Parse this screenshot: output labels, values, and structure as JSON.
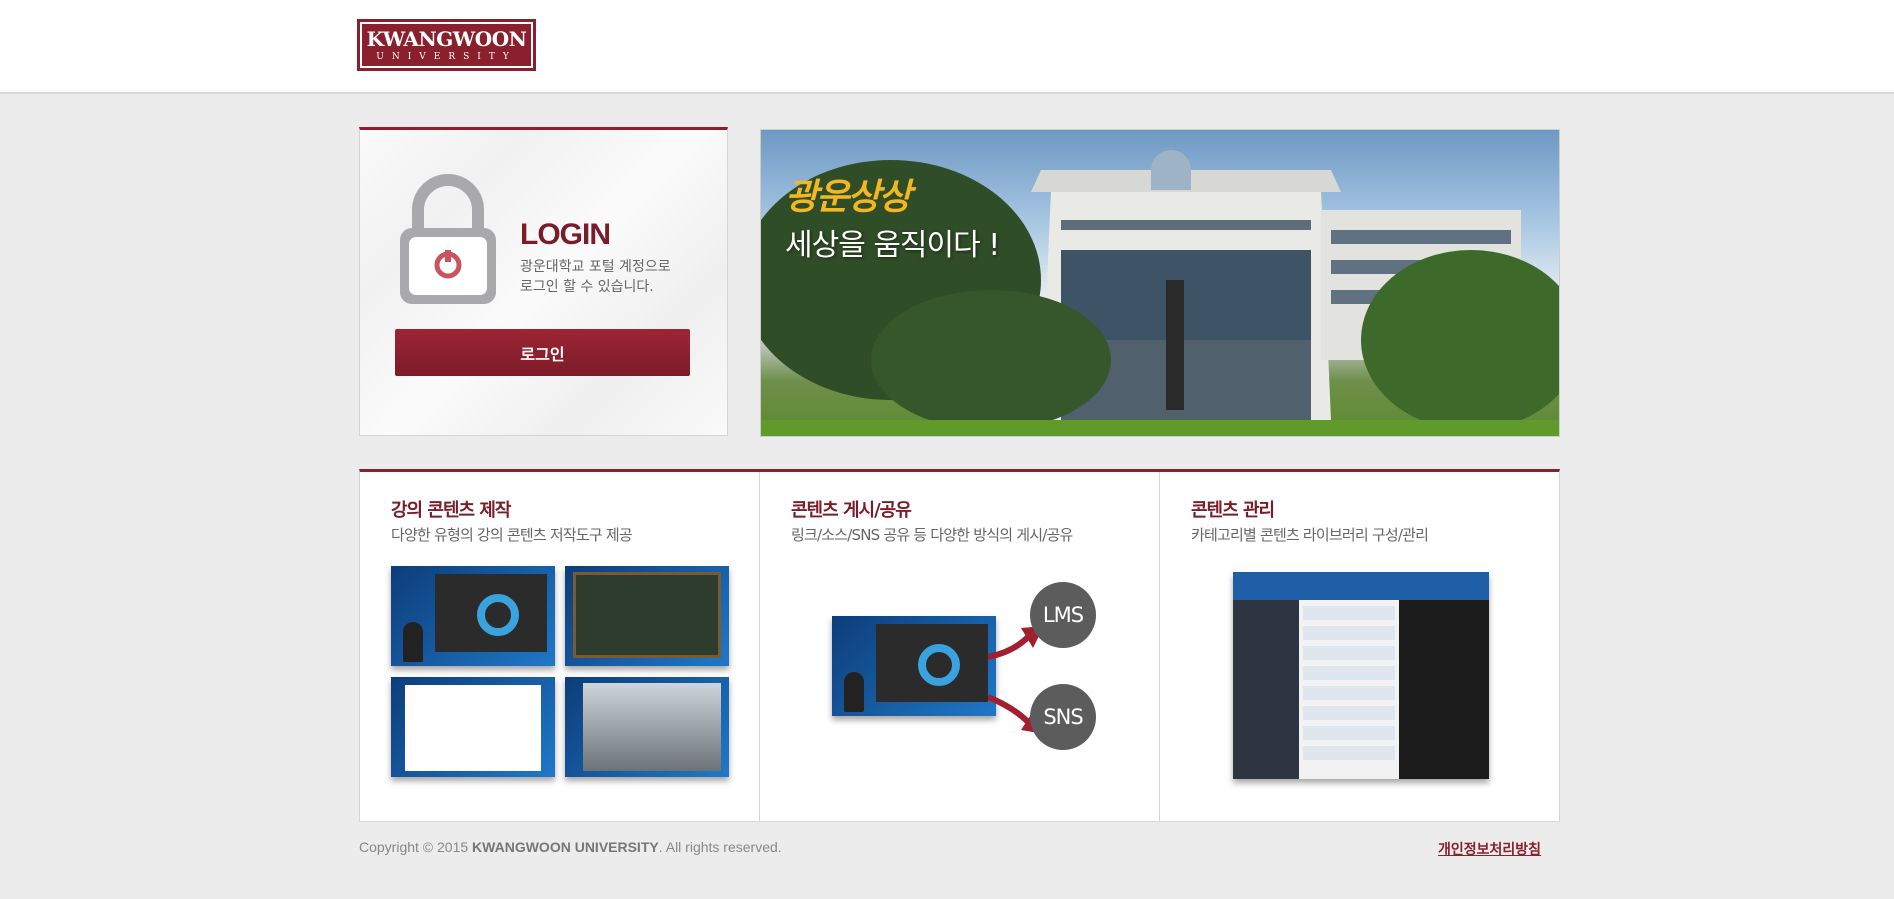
{
  "header": {
    "logo_line1": "KWANGWOON",
    "logo_line2": "UNIVERSITY"
  },
  "login": {
    "title": "LOGIN",
    "desc_line1": "광운대학교 포털 계정으로",
    "desc_line2": "로그인 할 수 있습니다.",
    "button_label": "로그인"
  },
  "banner": {
    "slogan_line1": "광운상상",
    "slogan_line2": "세상을 움직이다 !"
  },
  "features": [
    {
      "title": "강의 콘텐츠 제작",
      "desc": "다양한 유형의 강의 콘텐츠 저작도구 제공"
    },
    {
      "title": "콘텐츠 게시/공유",
      "desc": "링크/소스/SNS 공유 등 다양한 방식의 게시/공유"
    },
    {
      "title": "콘텐츠 관리",
      "desc": "카테고리별 콘텐츠 라이브러리 구성/관리"
    }
  ],
  "share_targets": {
    "lms": "LMS",
    "sns": "SNS"
  },
  "footer": {
    "copyright_prefix": "Copyright © 2015",
    "copyright_org": "KWANGWOON UNIVERSITY",
    "copyright_suffix": ". All rights reserved.",
    "privacy_link": "개인정보처리방침"
  },
  "colors": {
    "brand": "#8a1f2e",
    "background": "#ececec"
  }
}
